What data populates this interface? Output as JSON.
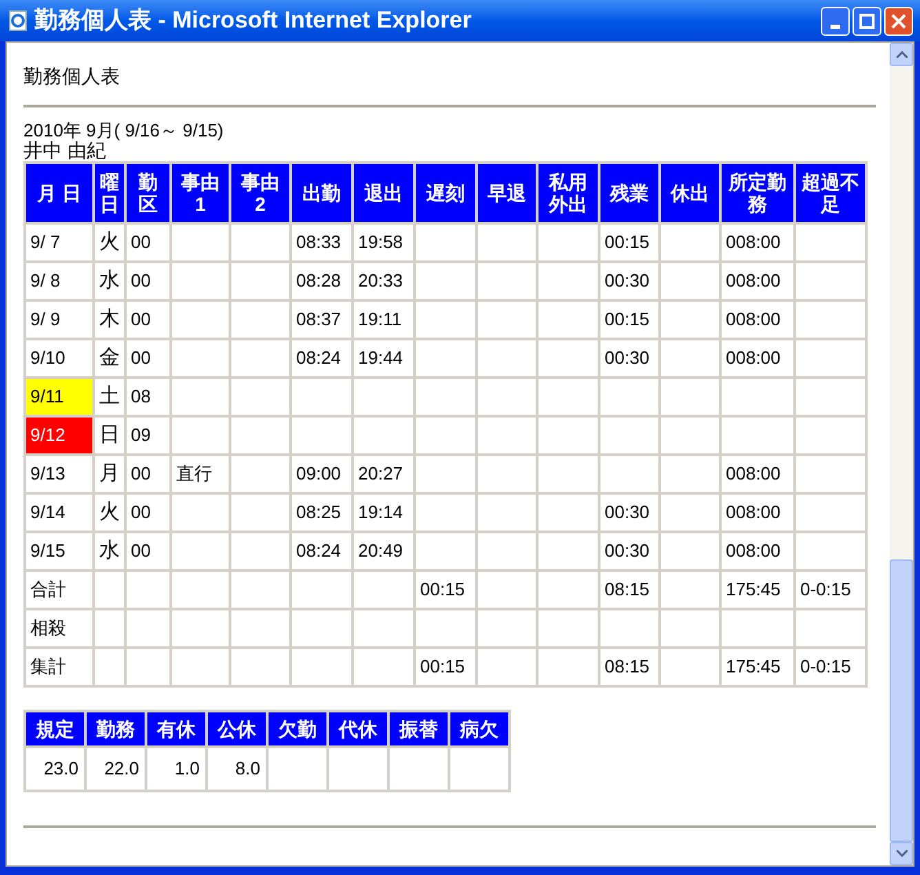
{
  "window": {
    "title": "勤務個人表 - Microsoft Internet Explorer"
  },
  "page": {
    "heading": "勤務個人表",
    "period": "2010年 9月( 9/16～ 9/15)",
    "employee": "井中 由紀"
  },
  "table": {
    "columns": [
      "月 日",
      "曜日",
      "勤区",
      "事由\n1",
      "事由\n2",
      "出勤",
      "退出",
      "遅刻",
      "早退",
      "私用外出",
      "残業",
      "休出",
      "所定勤務",
      "超過不足"
    ],
    "rows": [
      {
        "cells": [
          "9/ 7",
          "火",
          "00",
          null,
          null,
          "08:33",
          "19:58",
          null,
          null,
          null,
          "00:15",
          null,
          "008:00",
          null
        ]
      },
      {
        "cells": [
          "9/ 8",
          "水",
          "00",
          null,
          null,
          "08:28",
          "20:33",
          null,
          null,
          null,
          "00:30",
          null,
          "008:00",
          null
        ]
      },
      {
        "cells": [
          "9/ 9",
          "木",
          "00",
          null,
          null,
          "08:37",
          "19:11",
          null,
          null,
          null,
          "00:15",
          null,
          "008:00",
          null
        ]
      },
      {
        "cells": [
          "9/10",
          "金",
          "00",
          null,
          null,
          "08:24",
          "19:44",
          null,
          null,
          null,
          "00:30",
          null,
          "008:00",
          null
        ]
      },
      {
        "cells": [
          "9/11",
          "土",
          "08",
          null,
          null,
          null,
          null,
          null,
          null,
          null,
          null,
          null,
          null,
          null
        ],
        "color": "#ffff00"
      },
      {
        "cells": [
          "9/12",
          "日",
          "09",
          null,
          null,
          null,
          null,
          null,
          null,
          null,
          null,
          null,
          null,
          null
        ],
        "color": "#ff0000"
      },
      {
        "cells": [
          "9/13",
          "月",
          "00",
          "直行",
          null,
          "09:00",
          "20:27",
          null,
          null,
          null,
          null,
          null,
          "008:00",
          null
        ]
      },
      {
        "cells": [
          "9/14",
          "火",
          "00",
          null,
          null,
          "08:25",
          "19:14",
          null,
          null,
          null,
          "00:30",
          null,
          "008:00",
          null
        ]
      },
      {
        "cells": [
          "9/15",
          "水",
          "00",
          null,
          null,
          "08:24",
          "20:49",
          null,
          null,
          null,
          "00:30",
          null,
          "008:00",
          null
        ]
      },
      {
        "cells": [
          "合計",
          null,
          null,
          null,
          null,
          null,
          null,
          "00:15",
          null,
          null,
          "08:15",
          null,
          "175:45",
          "0-0:15"
        ]
      },
      {
        "cells": [
          "相殺",
          null,
          null,
          null,
          null,
          null,
          null,
          null,
          null,
          null,
          null,
          null,
          null,
          null
        ]
      },
      {
        "cells": [
          "集計",
          null,
          null,
          null,
          null,
          null,
          null,
          "00:15",
          null,
          null,
          "08:15",
          null,
          "175:45",
          "0-0:15"
        ]
      }
    ]
  },
  "summary": {
    "columns": [
      {
        "label": "規定",
        "value": "23.0"
      },
      {
        "label": "勤務",
        "value": "22.0"
      },
      {
        "label": "有休",
        "value": "1.0"
      },
      {
        "label": "公休",
        "value": "8.0"
      },
      {
        "label": "欠勤"
      },
      {
        "label": "代休"
      },
      {
        "label": "振替"
      },
      {
        "label": "病欠"
      }
    ]
  }
}
